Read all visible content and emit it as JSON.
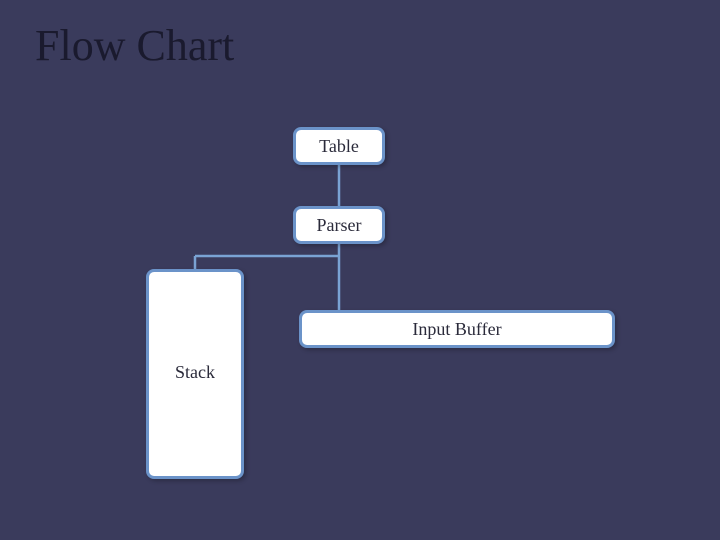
{
  "title": "Flow Chart",
  "nodes": {
    "table": "Table",
    "parser": "Parser",
    "stack": "Stack",
    "input_buffer": "Input Buffer"
  }
}
